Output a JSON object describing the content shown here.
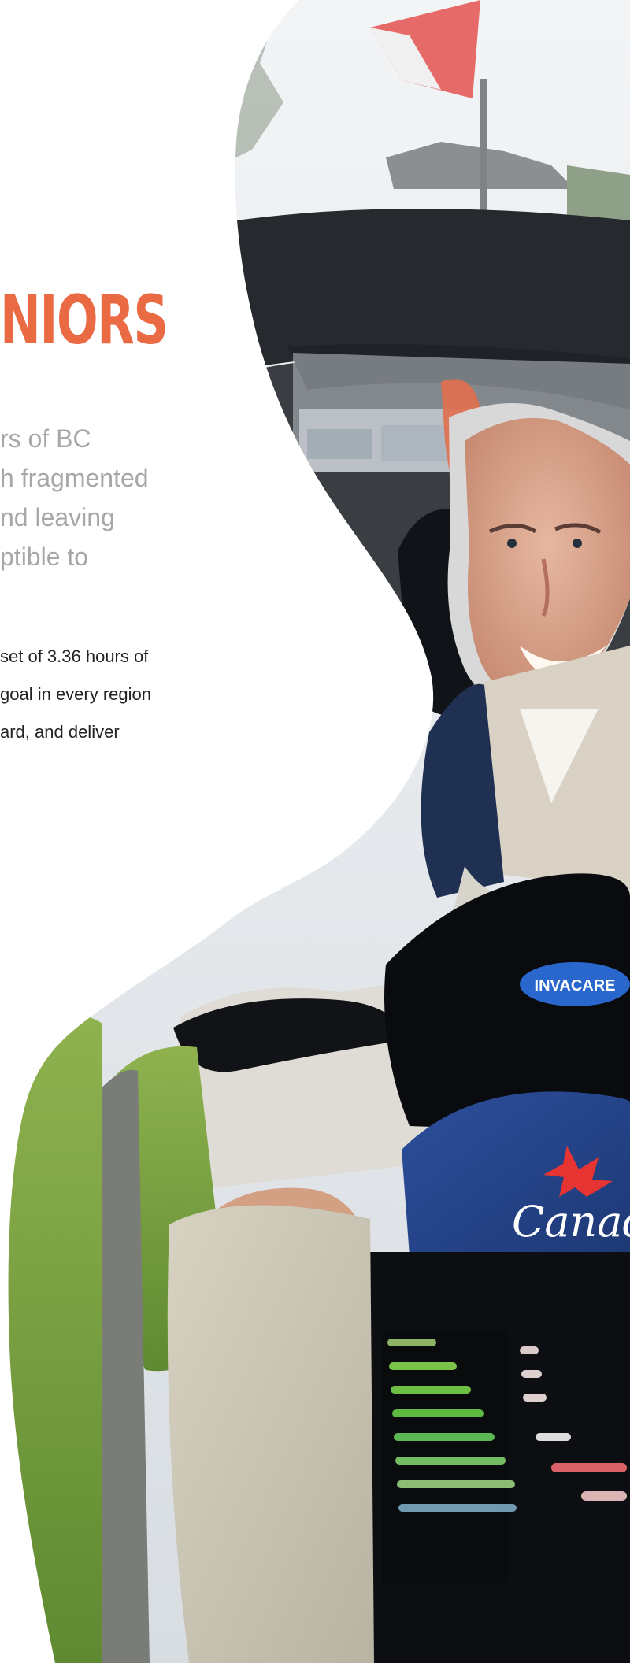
{
  "section": {
    "heading": "NIORS",
    "intro_lines": [
      "rs of BC",
      "h fragmented",
      "nd leaving",
      "ptible to"
    ],
    "body_lines": [
      "set of 3.36 hours of",
      "goal in every region",
      "ard, and deliver"
    ]
  },
  "photo": {
    "subject": "senior man smiling on mobility scooter",
    "scooter_brand": "INVACARE",
    "cap_text": "Canada"
  },
  "colors": {
    "heading": "#ea6a43",
    "intro_text": "#a7a7a7",
    "body_text": "#222222",
    "background": "#ffffff"
  }
}
